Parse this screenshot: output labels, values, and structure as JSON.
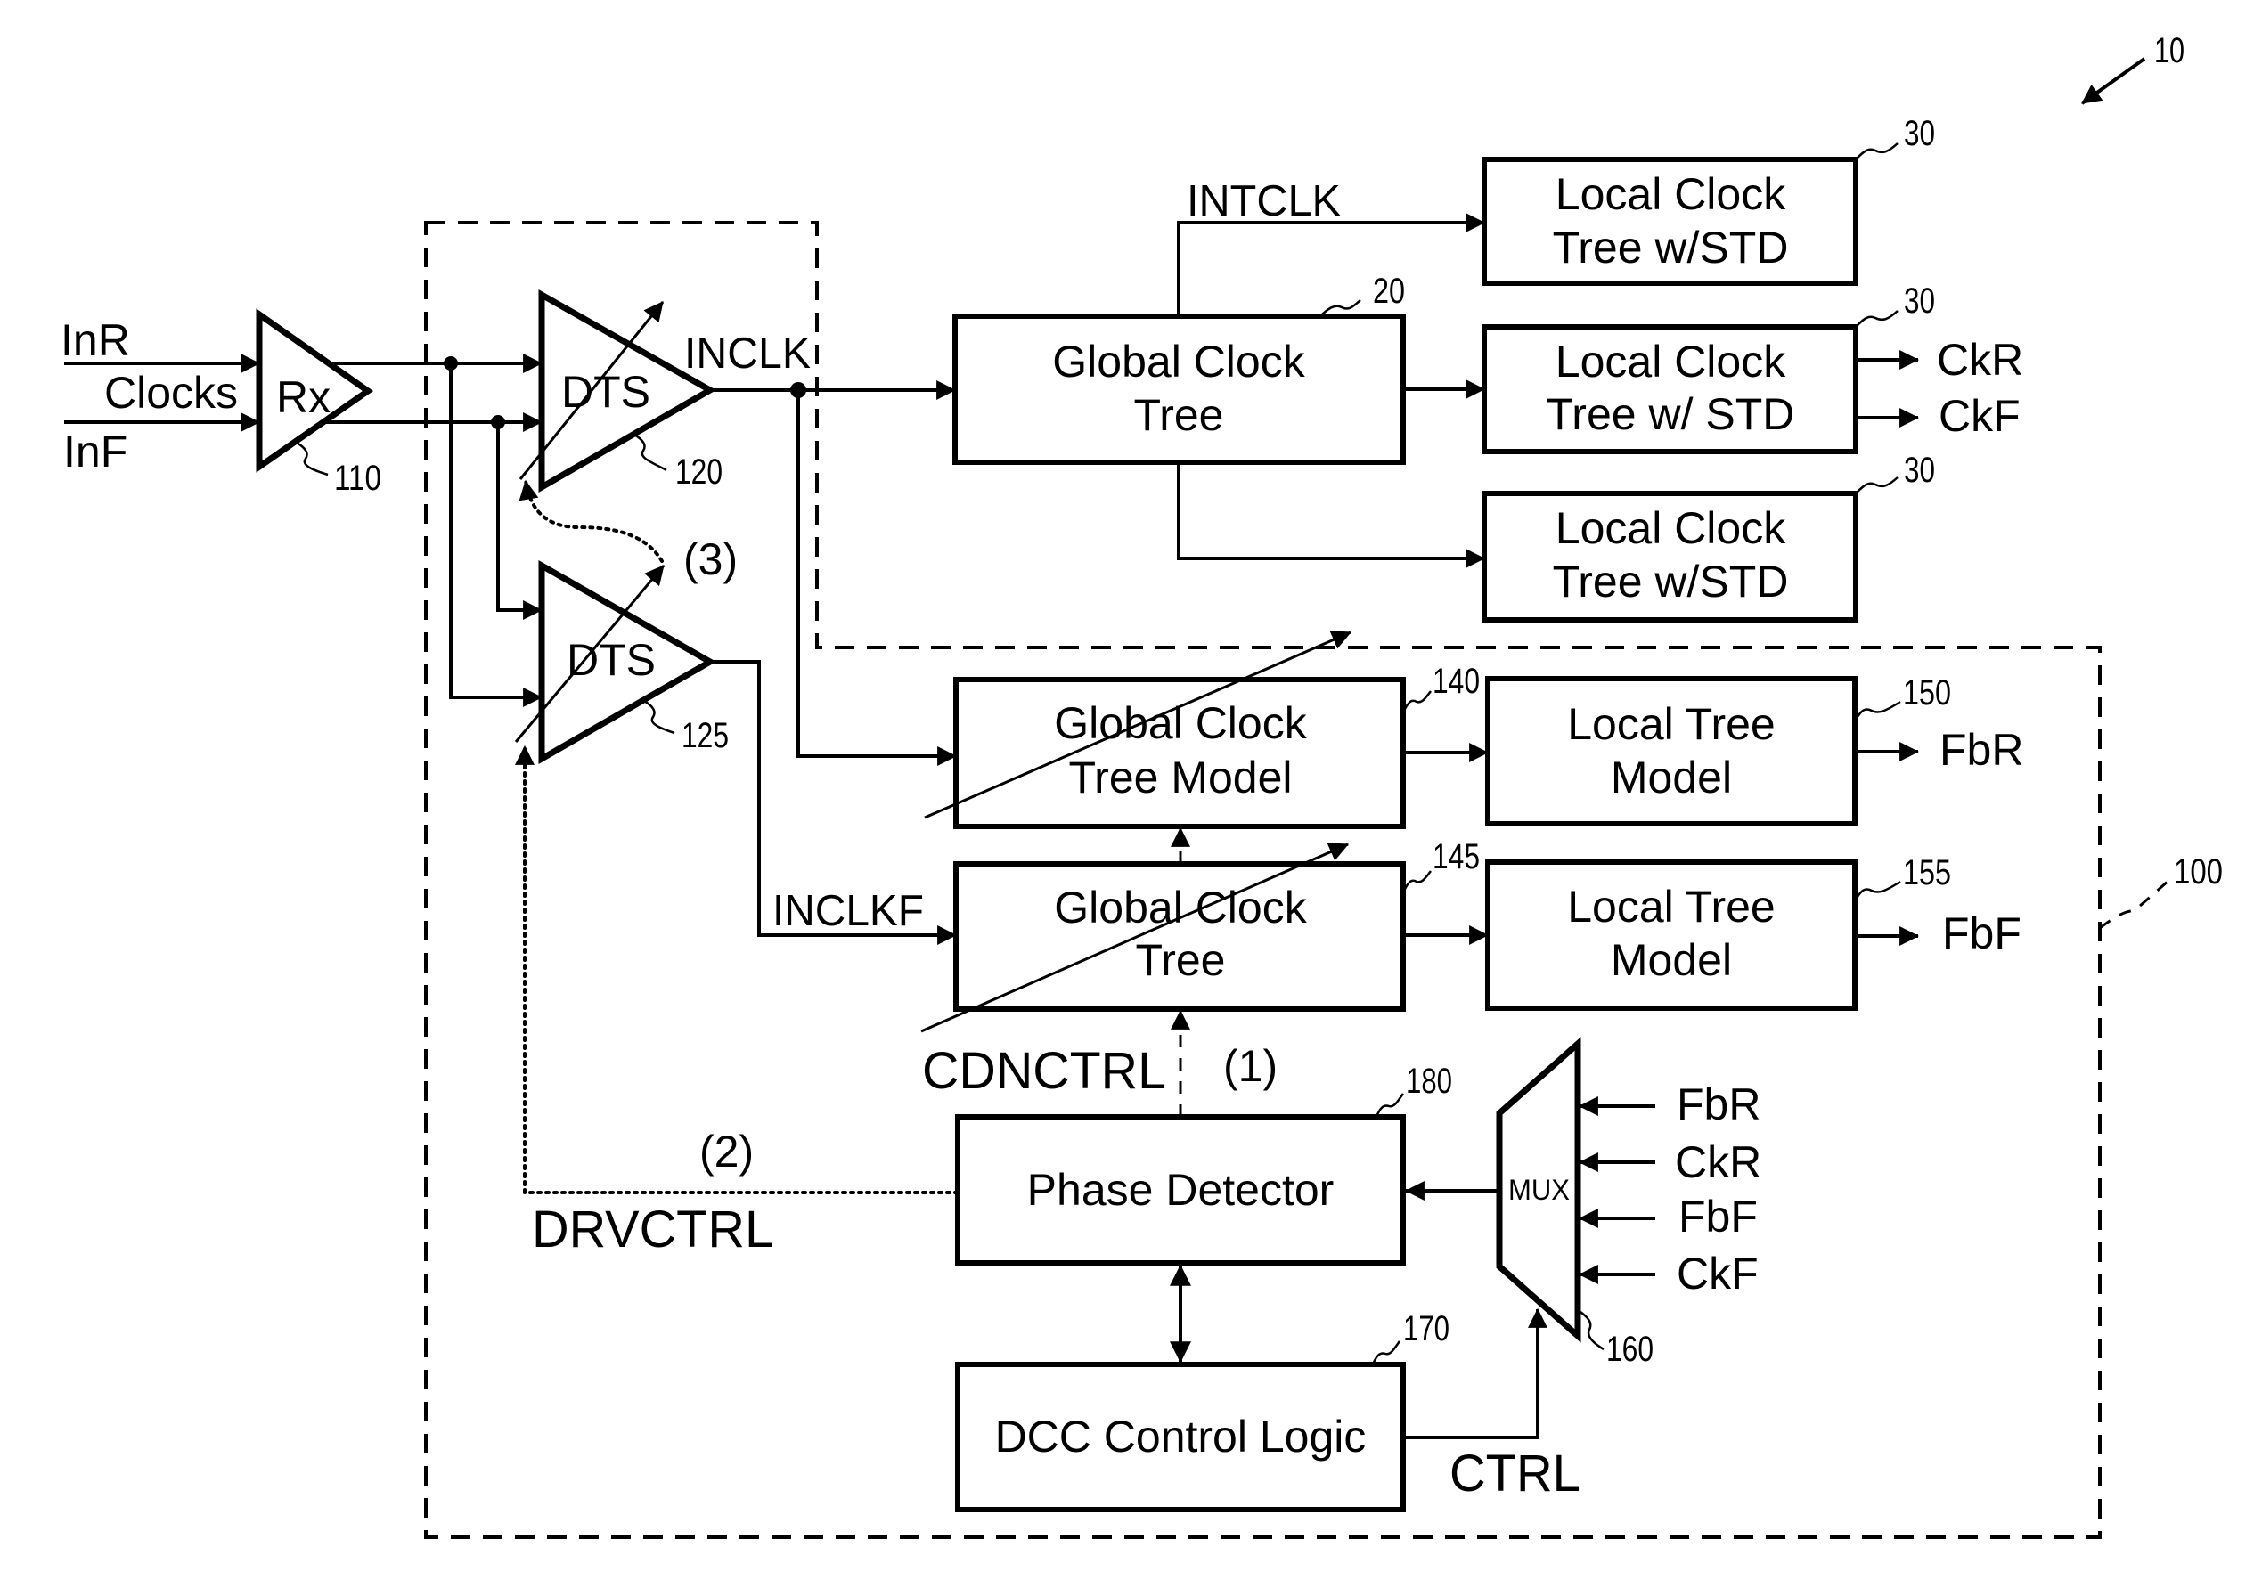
{
  "figure": {
    "number": "10"
  },
  "inputs": {
    "in_r": "InR",
    "clocks": "Clocks",
    "in_f": "InF"
  },
  "receiver": {
    "label": "Rx",
    "ref": "110"
  },
  "dts_primary": {
    "label": "DTS",
    "ref": "120",
    "output_signal": "INCLK"
  },
  "dts_secondary": {
    "label": "DTS",
    "ref": "125",
    "output_signal": "INCLKF"
  },
  "annotations": {
    "path1": "(1)",
    "path2": "(2)",
    "path3": "(3)"
  },
  "global_clock_tree": {
    "lines": [
      "Global Clock",
      "Tree"
    ],
    "ref": "20",
    "output_signal": "INTCLK"
  },
  "local_clock_trees": [
    {
      "lines": [
        "Local Clock",
        "Tree w/STD"
      ],
      "ref": "30"
    },
    {
      "lines": [
        "Local Clock",
        "Tree w/ STD"
      ],
      "ref": "30",
      "outputs": [
        "CkR",
        "CkF"
      ]
    },
    {
      "lines": [
        "Local Clock",
        "Tree w/STD"
      ],
      "ref": "30"
    }
  ],
  "dcc_block": {
    "ref": "100",
    "gct_model": {
      "lines": [
        "Global Clock",
        "Tree Model"
      ],
      "ref": "140"
    },
    "gct_replica": {
      "lines": [
        "Global Clock",
        "Tree"
      ],
      "ref": "145"
    },
    "ltm_rise": {
      "lines": [
        "Local Tree",
        "Model"
      ],
      "ref": "150",
      "output": "FbR"
    },
    "ltm_fall": {
      "lines": [
        "Local Tree",
        "Model"
      ],
      "ref": "155",
      "output": "FbF"
    },
    "cdn_control_signal": "CDNCTRL",
    "drv_control_signal": "DRVCTRL",
    "phase_detector": {
      "label": "Phase Detector",
      "ref": "180"
    },
    "dcc_logic": {
      "label": "DCC Control Logic",
      "ref": "170"
    },
    "ctrl_signal": "CTRL",
    "mux": {
      "label": "MUX",
      "ref": "160",
      "inputs": [
        "FbR",
        "CkR",
        "FbF",
        "CkF"
      ]
    }
  }
}
